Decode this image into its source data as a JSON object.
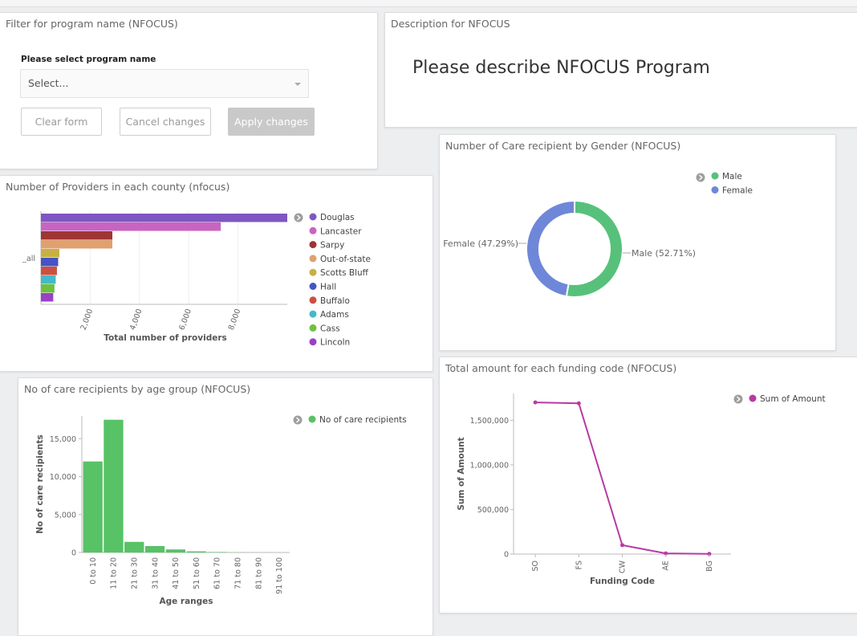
{
  "filter_panel": {
    "title": "Filter for program name (NFOCUS)",
    "control_label": "Please select program name",
    "select_placeholder": "Select...",
    "clear_label": "Clear form",
    "cancel_label": "Cancel changes",
    "apply_label": "Apply changes"
  },
  "description_panel": {
    "title": "Description for NFOCUS",
    "text": "Please describe NFOCUS Program"
  },
  "chart_data": [
    {
      "id": "providers",
      "type": "bar",
      "orientation": "horizontal",
      "title": "Number of Providers in each county (nfocus)",
      "xlabel": "Total number of providers",
      "category_label": "_all",
      "xlim": [
        0,
        10000
      ],
      "xticks": [
        "2,000",
        "4,000",
        "6,000",
        "8,000"
      ],
      "xtick_values": [
        2000,
        4000,
        6000,
        8000
      ],
      "legend_position": "right",
      "series": [
        {
          "name": "Douglas",
          "value": 10000,
          "color": "#7e57c2"
        },
        {
          "name": "Lancaster",
          "value": 7300,
          "color": "#c864c0"
        },
        {
          "name": "Sarpy",
          "value": 2900,
          "color": "#9e3533"
        },
        {
          "name": "Out-of-state",
          "value": 2900,
          "color": "#e0a070"
        },
        {
          "name": "Scotts Bluff",
          "value": 750,
          "color": "#c8b043"
        },
        {
          "name": "Hall",
          "value": 700,
          "color": "#4454c4"
        },
        {
          "name": "Buffalo",
          "value": 650,
          "color": "#cc5040"
        },
        {
          "name": "Adams",
          "value": 600,
          "color": "#46b8c8"
        },
        {
          "name": "Cass",
          "value": 550,
          "color": "#70c040"
        },
        {
          "name": "Lincoln",
          "value": 500,
          "color": "#9a40c8"
        }
      ]
    },
    {
      "id": "gender",
      "type": "pie",
      "donut": true,
      "title": "Number of Care recipient by Gender (NFOCUS)",
      "legend_position": "top-right",
      "slices": [
        {
          "name": "Male",
          "percent": 52.71,
          "label": "Male (52.71%)",
          "color": "#57c17b"
        },
        {
          "name": "Female",
          "percent": 47.29,
          "label": "Female (47.29%)",
          "color": "#6f87d8"
        }
      ]
    },
    {
      "id": "age",
      "type": "bar",
      "title": "No of care recipients by age group (NFOCUS)",
      "xlabel": "Age ranges",
      "ylabel": "No of care recipients",
      "ylim": [
        0,
        18000
      ],
      "yticks": [
        "0",
        "5,000",
        "10,000",
        "15,000"
      ],
      "ytick_values": [
        0,
        5000,
        10000,
        15000
      ],
      "categories": [
        "0 to 10",
        "11 to 20",
        "21 to 30",
        "31 to 40",
        "41 to 50",
        "51 to 60",
        "61 to 70",
        "71 to 80",
        "81 to 90",
        "91 to 100"
      ],
      "series": [
        {
          "name": "No of care recipients",
          "color": "#57c266",
          "values": [
            12000,
            17500,
            1400,
            850,
            400,
            150,
            60,
            20,
            10,
            5
          ]
        }
      ],
      "legend_position": "top-right"
    },
    {
      "id": "funding",
      "type": "line",
      "title": "Total amount for each funding code (NFOCUS)",
      "xlabel": "Funding Code",
      "ylabel": "Sum of Amount",
      "ylim": [
        0,
        1800000
      ],
      "yticks": [
        "0",
        "500,000",
        "1,000,000",
        "1,500,000"
      ],
      "ytick_values": [
        0,
        500000,
        1000000,
        1500000
      ],
      "categories": [
        "SO",
        "FS",
        "CW",
        "AE",
        "BG"
      ],
      "series": [
        {
          "name": "Sum of Amount",
          "color": "#b73aa3",
          "values": [
            1700000,
            1690000,
            100000,
            8000,
            2000
          ]
        }
      ],
      "legend_position": "top-right"
    }
  ],
  "icons": {
    "legend_toggle": "chevron-right-icon"
  }
}
